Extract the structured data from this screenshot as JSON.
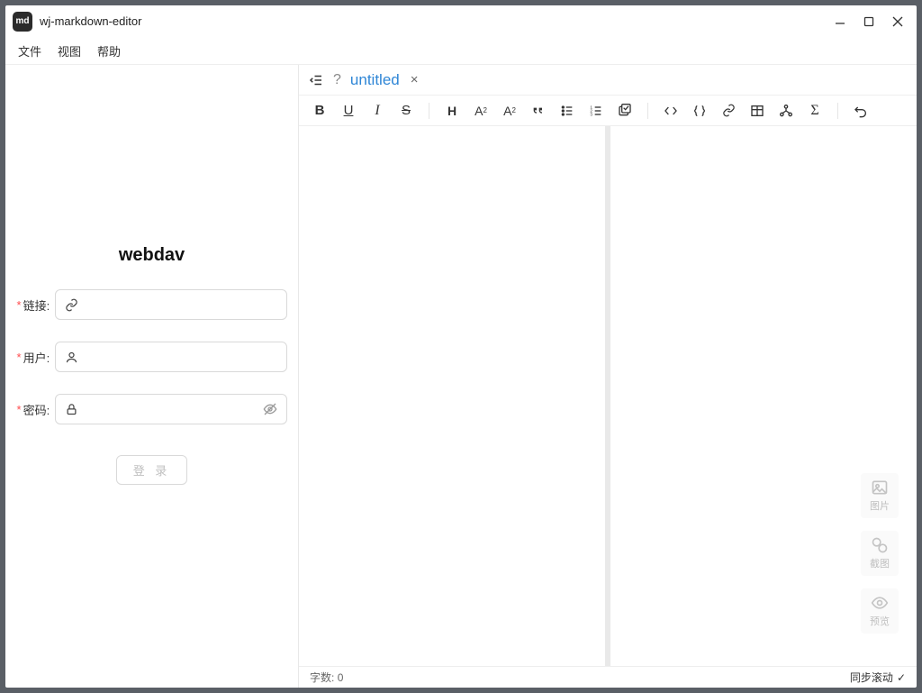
{
  "app": {
    "icon_text": "md",
    "title": "wj-markdown-editor"
  },
  "menu": {
    "file": "文件",
    "view": "视图",
    "help": "帮助"
  },
  "sidebar": {
    "heading": "webdav",
    "fields": {
      "link": {
        "label": "链接:",
        "value": ""
      },
      "user": {
        "label": "用户:",
        "value": ""
      },
      "password": {
        "label": "密码:",
        "value": ""
      }
    },
    "login_btn": "登 录"
  },
  "tab": {
    "qmark": "?",
    "name": "untitled",
    "close": "×"
  },
  "statusbar": {
    "wordcount_label": "字数:",
    "wordcount_value": "0",
    "sync_scroll": "同步滚动",
    "check": "✓"
  },
  "float": {
    "image": "图片",
    "screenshot": "截图",
    "preview": "预览"
  }
}
